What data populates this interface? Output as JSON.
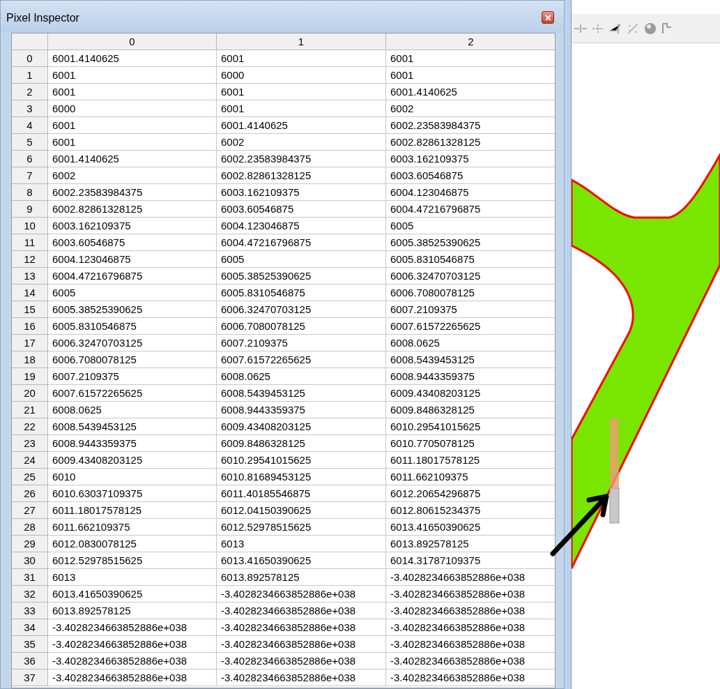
{
  "panel": {
    "title": "Pixel Inspector"
  },
  "table": {
    "columns": [
      "0",
      "1",
      "2"
    ],
    "rows": [
      {
        "index": "0",
        "cells": [
          "6001.4140625",
          "6001",
          "6001"
        ]
      },
      {
        "index": "1",
        "cells": [
          "6001",
          "6000",
          "6001"
        ]
      },
      {
        "index": "2",
        "cells": [
          "6001",
          "6001",
          "6001.4140625"
        ]
      },
      {
        "index": "3",
        "cells": [
          "6000",
          "6001",
          "6002"
        ]
      },
      {
        "index": "4",
        "cells": [
          "6001",
          "6001.4140625",
          "6002.23583984375"
        ]
      },
      {
        "index": "5",
        "cells": [
          "6001",
          "6002",
          "6002.82861328125"
        ]
      },
      {
        "index": "6",
        "cells": [
          "6001.4140625",
          "6002.23583984375",
          "6003.162109375"
        ]
      },
      {
        "index": "7",
        "cells": [
          "6002",
          "6002.82861328125",
          "6003.60546875"
        ]
      },
      {
        "index": "8",
        "cells": [
          "6002.23583984375",
          "6003.162109375",
          "6004.123046875"
        ]
      },
      {
        "index": "9",
        "cells": [
          "6002.82861328125",
          "6003.60546875",
          "6004.47216796875"
        ]
      },
      {
        "index": "10",
        "cells": [
          "6003.162109375",
          "6004.123046875",
          "6005"
        ]
      },
      {
        "index": "11",
        "cells": [
          "6003.60546875",
          "6004.47216796875",
          "6005.38525390625"
        ]
      },
      {
        "index": "12",
        "cells": [
          "6004.123046875",
          "6005",
          "6005.8310546875"
        ]
      },
      {
        "index": "13",
        "cells": [
          "6004.47216796875",
          "6005.38525390625",
          "6006.32470703125"
        ]
      },
      {
        "index": "14",
        "cells": [
          "6005",
          "6005.8310546875",
          "6006.7080078125"
        ]
      },
      {
        "index": "15",
        "cells": [
          "6005.38525390625",
          "6006.32470703125",
          "6007.2109375"
        ]
      },
      {
        "index": "16",
        "cells": [
          "6005.8310546875",
          "6006.7080078125",
          "6007.61572265625"
        ]
      },
      {
        "index": "17",
        "cells": [
          "6006.32470703125",
          "6007.2109375",
          "6008.0625"
        ]
      },
      {
        "index": "18",
        "cells": [
          "6006.7080078125",
          "6007.61572265625",
          "6008.5439453125"
        ]
      },
      {
        "index": "19",
        "cells": [
          "6007.2109375",
          "6008.0625",
          "6008.9443359375"
        ]
      },
      {
        "index": "20",
        "cells": [
          "6007.61572265625",
          "6008.5439453125",
          "6009.43408203125"
        ]
      },
      {
        "index": "21",
        "cells": [
          "6008.0625",
          "6008.9443359375",
          "6009.8486328125"
        ]
      },
      {
        "index": "22",
        "cells": [
          "6008.5439453125",
          "6009.43408203125",
          "6010.29541015625"
        ]
      },
      {
        "index": "23",
        "cells": [
          "6008.9443359375",
          "6009.8486328125",
          "6010.7705078125"
        ]
      },
      {
        "index": "24",
        "cells": [
          "6009.43408203125",
          "6010.29541015625",
          "6011.18017578125"
        ]
      },
      {
        "index": "25",
        "cells": [
          "6010",
          "6010.81689453125",
          "6011.662109375"
        ]
      },
      {
        "index": "26",
        "cells": [
          "6010.63037109375",
          "6011.40185546875",
          "6012.20654296875"
        ]
      },
      {
        "index": "27",
        "cells": [
          "6011.18017578125",
          "6012.04150390625",
          "6012.80615234375"
        ]
      },
      {
        "index": "28",
        "cells": [
          "6011.662109375",
          "6012.52978515625",
          "6013.41650390625"
        ]
      },
      {
        "index": "29",
        "cells": [
          "6012.0830078125",
          "6013",
          "6013.892578125"
        ]
      },
      {
        "index": "30",
        "cells": [
          "6012.52978515625",
          "6013.41650390625",
          "6014.31787109375"
        ]
      },
      {
        "index": "31",
        "cells": [
          "6013",
          "6013.892578125",
          "-3.4028234663852886e+038"
        ]
      },
      {
        "index": "32",
        "cells": [
          "6013.41650390625",
          "-3.4028234663852886e+038",
          "-3.4028234663852886e+038"
        ]
      },
      {
        "index": "33",
        "cells": [
          "6013.892578125",
          "-3.4028234663852886e+038",
          "-3.4028234663852886e+038"
        ]
      },
      {
        "index": "34",
        "cells": [
          "-3.4028234663852886e+038",
          "-3.4028234663852886e+038",
          "-3.4028234663852886e+038"
        ]
      },
      {
        "index": "35",
        "cells": [
          "-3.4028234663852886e+038",
          "-3.4028234663852886e+038",
          "-3.4028234663852886e+038"
        ]
      },
      {
        "index": "36",
        "cells": [
          "-3.4028234663852886e+038",
          "-3.4028234663852886e+038",
          "-3.4028234663852886e+038"
        ]
      },
      {
        "index": "37",
        "cells": [
          "-3.4028234663852886e+038",
          "-3.4028234663852886e+038",
          "-3.4028234663852886e+038"
        ]
      }
    ]
  }
}
